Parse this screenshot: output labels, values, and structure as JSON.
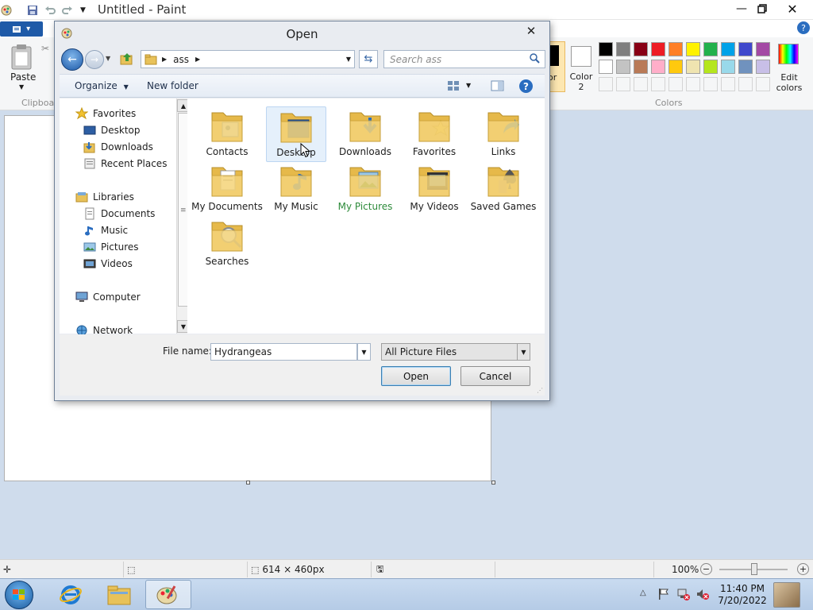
{
  "paint": {
    "title": "Untitled - Paint",
    "ribbon": {
      "paste_label": "Paste",
      "clipboard_group": "Clipboa",
      "color1_label_partial": "or",
      "color2_label": "Color 2",
      "colors_group": "Colors",
      "edit_colors_label": "Edit colors"
    },
    "palette": [
      "#000000",
      "#7f7f7f",
      "#880015",
      "#ed1c24",
      "#ff7f27",
      "#fff200",
      "#22b14c",
      "#00a2e8",
      "#3f48cc",
      "#a349a4",
      "#ffffff",
      "#c3c3c3",
      "#b97a57",
      "#ffaec9",
      "#ffc90e",
      "#efe4b0",
      "#b5e61d",
      "#99d9ea",
      "#7092be",
      "#c8bfe7"
    ],
    "status": {
      "image_size": "614 × 460px",
      "zoom": "100%"
    }
  },
  "dialog": {
    "title": "Open",
    "breadcrumb": "ass",
    "search_placeholder": "Search ass",
    "organize_label": "Organize",
    "new_folder_label": "New folder",
    "nav": {
      "favorites": "Favorites",
      "desktop": "Desktop",
      "downloads": "Downloads",
      "recent_places": "Recent Places",
      "libraries": "Libraries",
      "documents": "Documents",
      "music": "Music",
      "pictures": "Pictures",
      "videos": "Videos",
      "computer": "Computer",
      "network": "Network"
    },
    "folders": {
      "contacts": "Contacts",
      "desktop": "Desktop",
      "downloads": "Downloads",
      "favorites": "Favorites",
      "links": "Links",
      "my_documents": "My Documents",
      "my_music": "My Music",
      "my_pictures": "My Pictures",
      "my_videos": "My Videos",
      "saved_games": "Saved Games",
      "searches": "Searches"
    },
    "file_name_label": "File name:",
    "file_name_value": "Hydrangeas",
    "file_type_value": "All Picture Files",
    "open_button": "Open",
    "cancel_button": "Cancel"
  },
  "taskbar": {
    "time": "11:40 PM",
    "date": "7/20/2022"
  },
  "colors": {
    "accent_blue": "#1e5aa8",
    "my_pictures_text": "#2e8b3b",
    "folder_yellow": "#f5d479"
  }
}
